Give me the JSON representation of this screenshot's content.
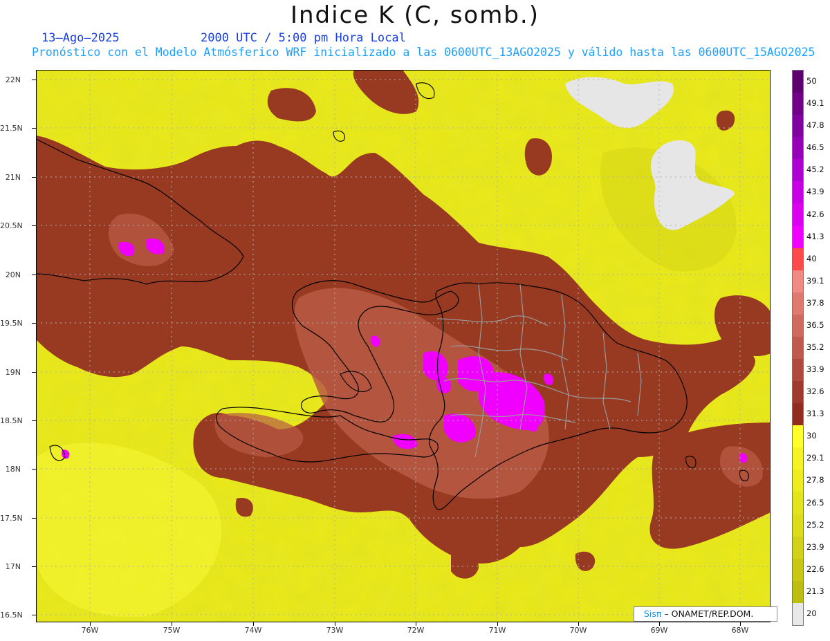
{
  "header": {
    "title": "Indice K (C, somb.)",
    "date": "13–Ago–2025",
    "time": "2000 UTC / 5:00 pm Hora Local",
    "description": "Pronóstico con el Modelo Atmósferico WRF inicializado a las 0600UTC_13AGO2025 y válido hasta las  0600UTC_15AGO2025"
  },
  "map": {
    "lat_labels": [
      "22N",
      "21.5N",
      "21N",
      "20.5N",
      "20N",
      "19.5N",
      "19N",
      "18.5N",
      "18N",
      "17.5N",
      "17N",
      "16.5N"
    ],
    "lon_labels": [
      "76W",
      "75W",
      "74W",
      "73W",
      "72W",
      "71W",
      "70W",
      "69W",
      "68W"
    ],
    "land_outline_color": "#000000",
    "province_line_color": "#999999",
    "gridline_color": "#b0b0b0"
  },
  "colorbar": {
    "labels": [
      "50",
      "49.1",
      "47.8",
      "46.5",
      "45.2",
      "43.9",
      "42.6",
      "41.3",
      "40",
      "39.1",
      "37.8",
      "36.5",
      "35.2",
      "33.9",
      "32.6",
      "31.3",
      "30",
      "29.1",
      "27.8",
      "26.5",
      "25.2",
      "23.9",
      "22.6",
      "21.3",
      "20"
    ],
    "colors": [
      "#5c0070",
      "#700088",
      "#8000a0",
      "#9600b8",
      "#ae00d0",
      "#c800e4",
      "#dc00f0",
      "#f000ff",
      "#ff4a4a",
      "#f08a82",
      "#e07a6c",
      "#d06a5c",
      "#c05a4c",
      "#b04a3c",
      "#a03a2c",
      "#922c1e",
      "#ffff2c",
      "#f4f424",
      "#ecec20",
      "#e4e41c",
      "#dcdc1a",
      "#d2d216",
      "#c8c812",
      "#bebe10",
      "#e8e8e8"
    ]
  },
  "credit": {
    "brand": "Sisπ",
    "org": "– ONAMET/REP.DOM."
  }
}
